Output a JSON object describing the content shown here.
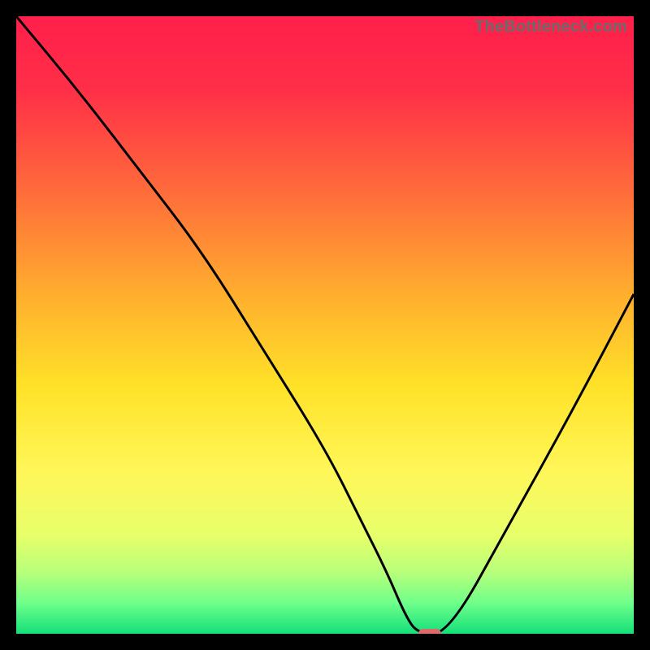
{
  "watermark": "TheBottleneck.com",
  "colors": {
    "gradient_stops": [
      {
        "pct": 0,
        "color": "#ff1f4b"
      },
      {
        "pct": 12,
        "color": "#ff2f47"
      },
      {
        "pct": 28,
        "color": "#ff6a3b"
      },
      {
        "pct": 45,
        "color": "#ffae2e"
      },
      {
        "pct": 60,
        "color": "#ffe228"
      },
      {
        "pct": 74,
        "color": "#fff75a"
      },
      {
        "pct": 84,
        "color": "#e8ff6a"
      },
      {
        "pct": 90,
        "color": "#b8ff7a"
      },
      {
        "pct": 95,
        "color": "#6fff8a"
      },
      {
        "pct": 100,
        "color": "#14e07a"
      }
    ],
    "curve": "#000000",
    "marker": "#e06a6a",
    "frame": "#000000",
    "panel": "#ffffff"
  },
  "chart_data": {
    "type": "line",
    "title": "",
    "xlabel": "",
    "ylabel": "",
    "xlim": [
      0,
      100
    ],
    "ylim": [
      0,
      100
    ],
    "series": [
      {
        "name": "curve",
        "x": [
          0,
          10,
          20,
          30,
          40,
          50,
          56,
          60,
          63,
          65,
          70,
          80,
          90,
          100
        ],
        "y": [
          100,
          88,
          75,
          62,
          46,
          30,
          18,
          10,
          3,
          0,
          0,
          18,
          36,
          55
        ]
      }
    ],
    "marker": {
      "x": 67,
      "y": 0
    }
  }
}
